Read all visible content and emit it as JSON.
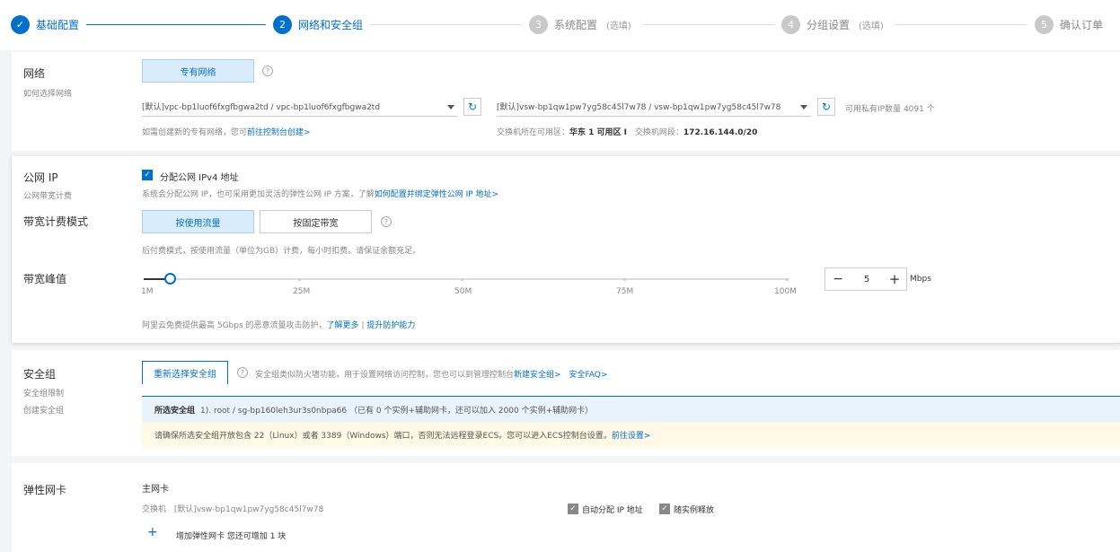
{
  "steps": [
    {
      "num": "✓",
      "label": "基础配置",
      "opt": ""
    },
    {
      "num": "2",
      "label": "网络和安全组",
      "opt": ""
    },
    {
      "num": "3",
      "label": "系统配置",
      "opt": "(选填)"
    },
    {
      "num": "4",
      "label": "分组设置",
      "opt": "(选填)"
    },
    {
      "num": "5",
      "label": "确认订单",
      "opt": ""
    }
  ],
  "network": {
    "label": "网络",
    "sub": "如何选择网络",
    "type_button": "专有网络",
    "vpc_select": "[默认]vpc-bp1luof6fxgfbgwa2td / vpc-bp1luof6fxgfbgwa2td",
    "vsw_select": "[默认]vsw-bp1qw1pw7yg58c45l7w78 / vsw-bp1qw1pw7yg58c45l7w78",
    "available_ip": "可用私有IP数量 4091 个",
    "hint_prefix": "如需创建新的专有网络，您可",
    "hint_link": "前往控制台创建>",
    "zone_label": "交换机所在可用区：",
    "zone_value": "华东 1 可用区 I",
    "cidr_label": "交换机网段：",
    "cidr_value": "172.16.144.0/20"
  },
  "public_ip": {
    "label": "公网 IP",
    "sub": "公网带宽计费",
    "checkbox_label": "分配公网 IPv4 地址",
    "desc_prefix": "系统会分配公网 IP，也可采用更加灵活的弹性公网 IP 方案，了解",
    "desc_link": "如何配置并绑定弹性公网 IP 地址>",
    "billing_label": "带宽计费模式",
    "billing_options": [
      "按使用流量",
      "按固定带宽"
    ],
    "billing_desc": "后付费模式，按使用流量（单位为GB）计费，每小时扣费。请保证余额充足。",
    "bandwidth_label": "带宽峰值",
    "slider_marks": [
      "1M",
      "25M",
      "50M",
      "75M",
      "100M"
    ],
    "bandwidth_value": "5",
    "bandwidth_unit": "Mbps",
    "bandwidth_level": 5,
    "ddos_prefix": "阿里云免费提供最高 5Gbps 的恶意流量攻击防护，",
    "ddos_link1": "了解更多",
    "ddos_sep": "|",
    "ddos_link2": "提升防护能力"
  },
  "security": {
    "label": "安全组",
    "sub1": "安全组限制",
    "sub2": "创建安全组",
    "button": "重新选择安全组",
    "desc": "安全组类似防火墙功能，用于设置网络访问控制，您也可以到管理控制台",
    "link1": "新建安全组>",
    "link2": "安全FAQ>",
    "selected_label": "所选安全组",
    "selected_value": "1). root / sg-bp160leh3ur3s0nbpa66 （已有 0 个实例+辅助网卡，还可以加入 2000 个实例+辅助网卡）",
    "warning": "请确保所选安全组开放包含 22（Linux）或者 3389（Windows）端口，否则无法远程登录ECS。您可以进入ECS控制台设置。",
    "warning_link": "前往设置>"
  },
  "eni": {
    "label": "弹性网卡",
    "main_nic": "主网卡",
    "switch_prefix": "交换机",
    "switch_value": "[默认]vsw-bp1qw1pw7yg58c45l7w78",
    "auto_ip": "自动分配 IP 地址",
    "release_with": "随实例释放",
    "add_label": "增加弹性网卡 您还可增加 1 块",
    "plus": "+"
  },
  "colors": {
    "primary": "#0070cc",
    "warning_bg": "#fff9e6",
    "info_bg": "#e8f3fd"
  },
  "icons": {
    "help": "question-circle-icon",
    "refresh": "refresh-icon",
    "check": "check-icon",
    "minus": "minus-icon",
    "plus": "plus-icon"
  }
}
